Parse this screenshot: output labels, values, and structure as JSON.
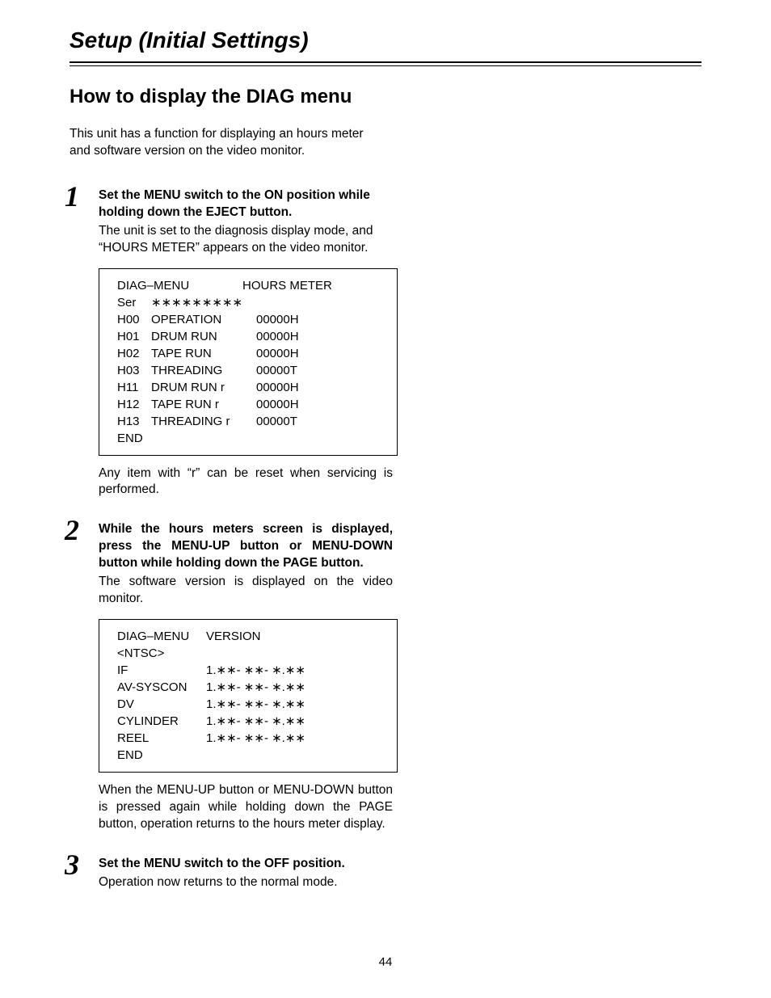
{
  "page_title": "Setup (Initial Settings)",
  "section_title": "How to display the DIAG menu",
  "intro": "This unit has a function for displaying an hours meter and software version on the video monitor.",
  "step1": {
    "num": "1",
    "head": "Set the MENU switch to the ON position while holding down the EJECT button.",
    "body": "The unit is set to the diagnosis display mode, and “HOURS METER” appears on the video monitor.",
    "note": "Any item with “r” can be reset when servicing is performed."
  },
  "hours_screen": {
    "header_left": "DIAG–MENU",
    "header_right": "HOURS METER",
    "ser_label": "Ser",
    "ser_value": "∗∗∗∗∗∗∗∗∗",
    "rows": [
      {
        "code": "H00",
        "label": "OPERATION",
        "value": "00000H"
      },
      {
        "code": "H01",
        "label": "DRUM RUN",
        "value": "00000H"
      },
      {
        "code": "H02",
        "label": "TAPE RUN",
        "value": "00000H"
      },
      {
        "code": "H03",
        "label": "THREADING",
        "value": "00000T"
      },
      {
        "code": "H11",
        "label": "DRUM RUN r",
        "value": "00000H"
      },
      {
        "code": "H12",
        "label": "TAPE RUN r",
        "value": "00000H"
      },
      {
        "code": "H13",
        "label": "THREADING r",
        "value": "00000T"
      }
    ],
    "end": "END"
  },
  "step2": {
    "num": "2",
    "head": "While the hours meters screen is displayed, press the MENU-UP button or MENU-DOWN button while holding down the PAGE button.",
    "body": "The software version is displayed on the video monitor.",
    "note": "When the MENU-UP button or MENU-DOWN button is pressed again while holding down the PAGE button, operation returns to the hours meter display."
  },
  "version_screen": {
    "header_left": "DIAG–MENU",
    "header_right": "VERSION",
    "sub": "<NTSC>",
    "rows": [
      {
        "label": "IF",
        "value": "1.∗∗- ∗∗- ∗.∗∗"
      },
      {
        "label": "AV-SYSCON",
        "value": "1.∗∗- ∗∗- ∗.∗∗"
      },
      {
        "label": "DV",
        "value": "1.∗∗- ∗∗- ∗.∗∗"
      },
      {
        "label": "CYLINDER",
        "value": "1.∗∗- ∗∗- ∗.∗∗"
      },
      {
        "label": "REEL",
        "value": "1.∗∗- ∗∗- ∗.∗∗"
      }
    ],
    "end": "END"
  },
  "step3": {
    "num": "3",
    "head": "Set the MENU switch to the OFF position.",
    "body": "Operation now returns to the normal mode."
  },
  "page_number": "44"
}
